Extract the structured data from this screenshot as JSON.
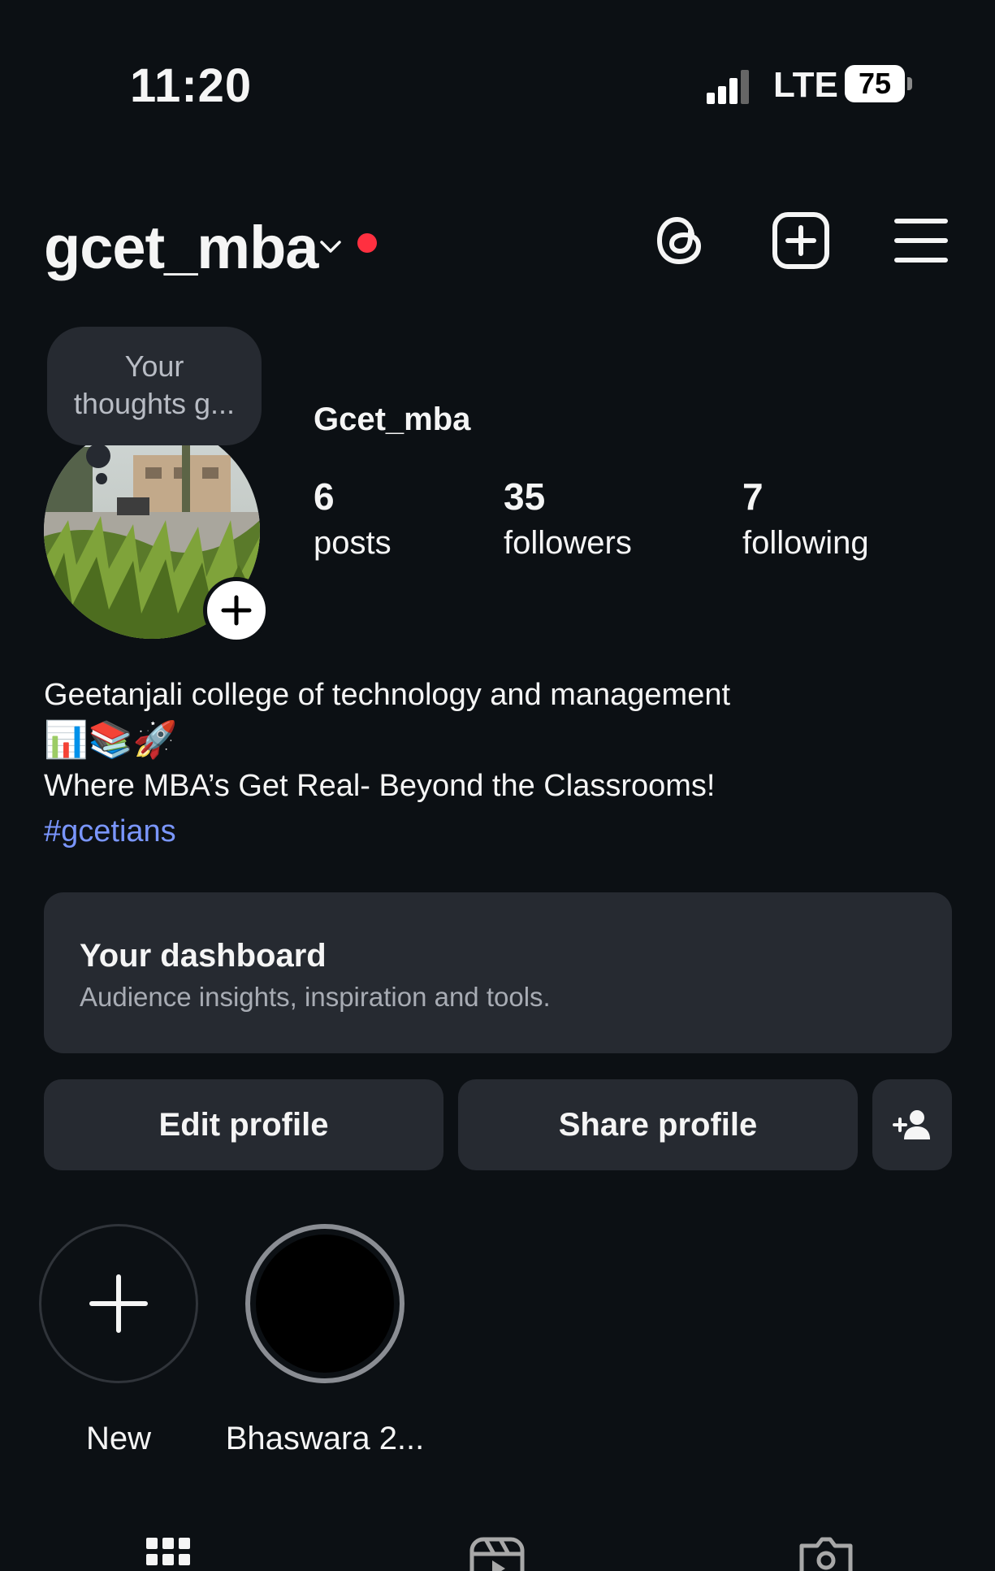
{
  "status_bar": {
    "time": "11:20",
    "network": "LTE",
    "battery": "75"
  },
  "header": {
    "username": "gcet_mba",
    "icons": [
      "threads-icon",
      "plus-square-icon",
      "menu-icon"
    ],
    "notification_color": "#ff3040"
  },
  "profile": {
    "note_bubble": [
      "Your",
      "thoughts g..."
    ],
    "display_name": "Gcet_mba",
    "stats": [
      {
        "value": "6",
        "label": "posts"
      },
      {
        "value": "35",
        "label": "followers"
      },
      {
        "value": "7",
        "label": "following"
      }
    ],
    "bio": {
      "line1": "Geetanjali college of technology and management",
      "emojis": "📊📚🚀",
      "line3": "Where MBA’s Get Real- Beyond the Classrooms!",
      "hashtag": "#gcetians"
    }
  },
  "dashboard": {
    "title": "Your dashboard",
    "subtitle": "Audience insights, inspiration and tools."
  },
  "buttons": {
    "edit": "Edit profile",
    "share": "Share profile"
  },
  "highlights": [
    {
      "label": "New"
    },
    {
      "label": "Bhaswara 2..."
    }
  ],
  "tabs": [
    "grid-icon",
    "reels-icon",
    "tagged-icon"
  ],
  "colors": {
    "background": "#0c1014",
    "surface": "#262a31",
    "link": "#7a96ff"
  }
}
